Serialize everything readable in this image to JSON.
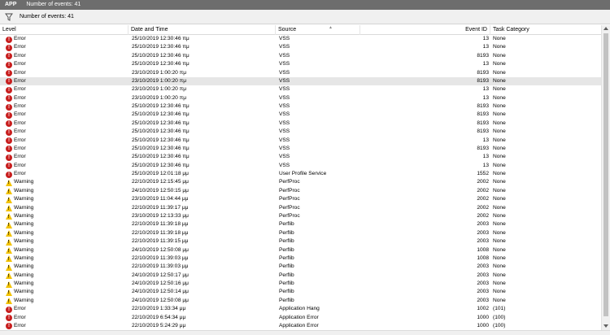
{
  "titlebar": {
    "app": "APP",
    "count": "Number of events: 41"
  },
  "filterbar": {
    "count": "Number of events: 41"
  },
  "columns": {
    "level": "Level",
    "date": "Date and Time",
    "source": "Source",
    "id": "Event ID",
    "category": "Task Category"
  },
  "rows": [
    {
      "level": "Error",
      "date": "25/10/2019 12:30:46 πμ",
      "source": "VSS",
      "id": "13",
      "category": "None"
    },
    {
      "level": "Error",
      "date": "25/10/2019 12:30:46 πμ",
      "source": "VSS",
      "id": "13",
      "category": "None"
    },
    {
      "level": "Error",
      "date": "25/10/2019 12:30:46 πμ",
      "source": "VSS",
      "id": "8193",
      "category": "None"
    },
    {
      "level": "Error",
      "date": "25/10/2019 12:30:46 πμ",
      "source": "VSS",
      "id": "13",
      "category": "None"
    },
    {
      "level": "Error",
      "date": "23/10/2019 1:00:20 πμ",
      "source": "VSS",
      "id": "8193",
      "category": "None"
    },
    {
      "level": "Error",
      "date": "23/10/2019 1:00:20 πμ",
      "source": "VSS",
      "id": "8193",
      "category": "None",
      "selected": true
    },
    {
      "level": "Error",
      "date": "23/10/2019 1:00:20 πμ",
      "source": "VSS",
      "id": "13",
      "category": "None"
    },
    {
      "level": "Error",
      "date": "23/10/2019 1:00:20 πμ",
      "source": "VSS",
      "id": "13",
      "category": "None"
    },
    {
      "level": "Error",
      "date": "25/10/2019 12:30:46 πμ",
      "source": "VSS",
      "id": "8193",
      "category": "None"
    },
    {
      "level": "Error",
      "date": "25/10/2019 12:30:46 πμ",
      "source": "VSS",
      "id": "8193",
      "category": "None"
    },
    {
      "level": "Error",
      "date": "25/10/2019 12:30:46 πμ",
      "source": "VSS",
      "id": "8193",
      "category": "None"
    },
    {
      "level": "Error",
      "date": "25/10/2019 12:30:46 πμ",
      "source": "VSS",
      "id": "8193",
      "category": "None"
    },
    {
      "level": "Error",
      "date": "25/10/2019 12:30:46 πμ",
      "source": "VSS",
      "id": "13",
      "category": "None"
    },
    {
      "level": "Error",
      "date": "25/10/2019 12:30:46 πμ",
      "source": "VSS",
      "id": "8193",
      "category": "None"
    },
    {
      "level": "Error",
      "date": "25/10/2019 12:30:46 πμ",
      "source": "VSS",
      "id": "13",
      "category": "None"
    },
    {
      "level": "Error",
      "date": "25/10/2019 12:30:46 πμ",
      "source": "VSS",
      "id": "13",
      "category": "None"
    },
    {
      "level": "Error",
      "date": "25/10/2019 12:01:18 μμ",
      "source": "User Profile Service",
      "id": "1552",
      "category": "None"
    },
    {
      "level": "Warning",
      "date": "22/10/2019 12:15:45 μμ",
      "source": "PerfProc",
      "id": "2002",
      "category": "None"
    },
    {
      "level": "Warning",
      "date": "24/10/2019 12:50:15 μμ",
      "source": "PerfProc",
      "id": "2002",
      "category": "None"
    },
    {
      "level": "Warning",
      "date": "23/10/2019 11:04:44 μμ",
      "source": "PerfProc",
      "id": "2002",
      "category": "None"
    },
    {
      "level": "Warning",
      "date": "22/10/2019 11:39:17 μμ",
      "source": "PerfProc",
      "id": "2002",
      "category": "None"
    },
    {
      "level": "Warning",
      "date": "23/10/2019 12:13:33 μμ",
      "source": "PerfProc",
      "id": "2002",
      "category": "None"
    },
    {
      "level": "Warning",
      "date": "22/10/2019 11:39:18 μμ",
      "source": "Perflib",
      "id": "2003",
      "category": "None"
    },
    {
      "level": "Warning",
      "date": "22/10/2019 11:39:18 μμ",
      "source": "Perflib",
      "id": "2003",
      "category": "None"
    },
    {
      "level": "Warning",
      "date": "22/10/2019 11:39:15 μμ",
      "source": "Perflib",
      "id": "2003",
      "category": "None"
    },
    {
      "level": "Warning",
      "date": "24/10/2019 12:50:08 μμ",
      "source": "Perflib",
      "id": "1008",
      "category": "None"
    },
    {
      "level": "Warning",
      "date": "22/10/2019 11:39:03 μμ",
      "source": "Perflib",
      "id": "1008",
      "category": "None"
    },
    {
      "level": "Warning",
      "date": "22/10/2019 11:39:03 μμ",
      "source": "Perflib",
      "id": "2003",
      "category": "None"
    },
    {
      "level": "Warning",
      "date": "24/10/2019 12:50:17 μμ",
      "source": "Perflib",
      "id": "2003",
      "category": "None"
    },
    {
      "level": "Warning",
      "date": "24/10/2019 12:50:16 μμ",
      "source": "Perflib",
      "id": "2003",
      "category": "None"
    },
    {
      "level": "Warning",
      "date": "24/10/2019 12:50:14 μμ",
      "source": "Perflib",
      "id": "2003",
      "category": "None"
    },
    {
      "level": "Warning",
      "date": "24/10/2019 12:50:08 μμ",
      "source": "Perflib",
      "id": "2003",
      "category": "None"
    },
    {
      "level": "Error",
      "date": "22/10/2019 1:33:34 μμ",
      "source": "Application Hang",
      "id": "1002",
      "category": "(101)"
    },
    {
      "level": "Error",
      "date": "22/10/2019 6:54:34 μμ",
      "source": "Application Error",
      "id": "1000",
      "category": "(100)"
    },
    {
      "level": "Error",
      "date": "22/10/2019 5:24:29 μμ",
      "source": "Application Error",
      "id": "1000",
      "category": "(100)"
    }
  ],
  "icons": {
    "error": "error-icon",
    "warning": "warning-icon",
    "filter": "filter-icon"
  },
  "colors": {
    "error": "#c81e1e",
    "warning": "#f2c200",
    "titlebar": "#6d6d6d",
    "selected": "#e6e6e6"
  }
}
